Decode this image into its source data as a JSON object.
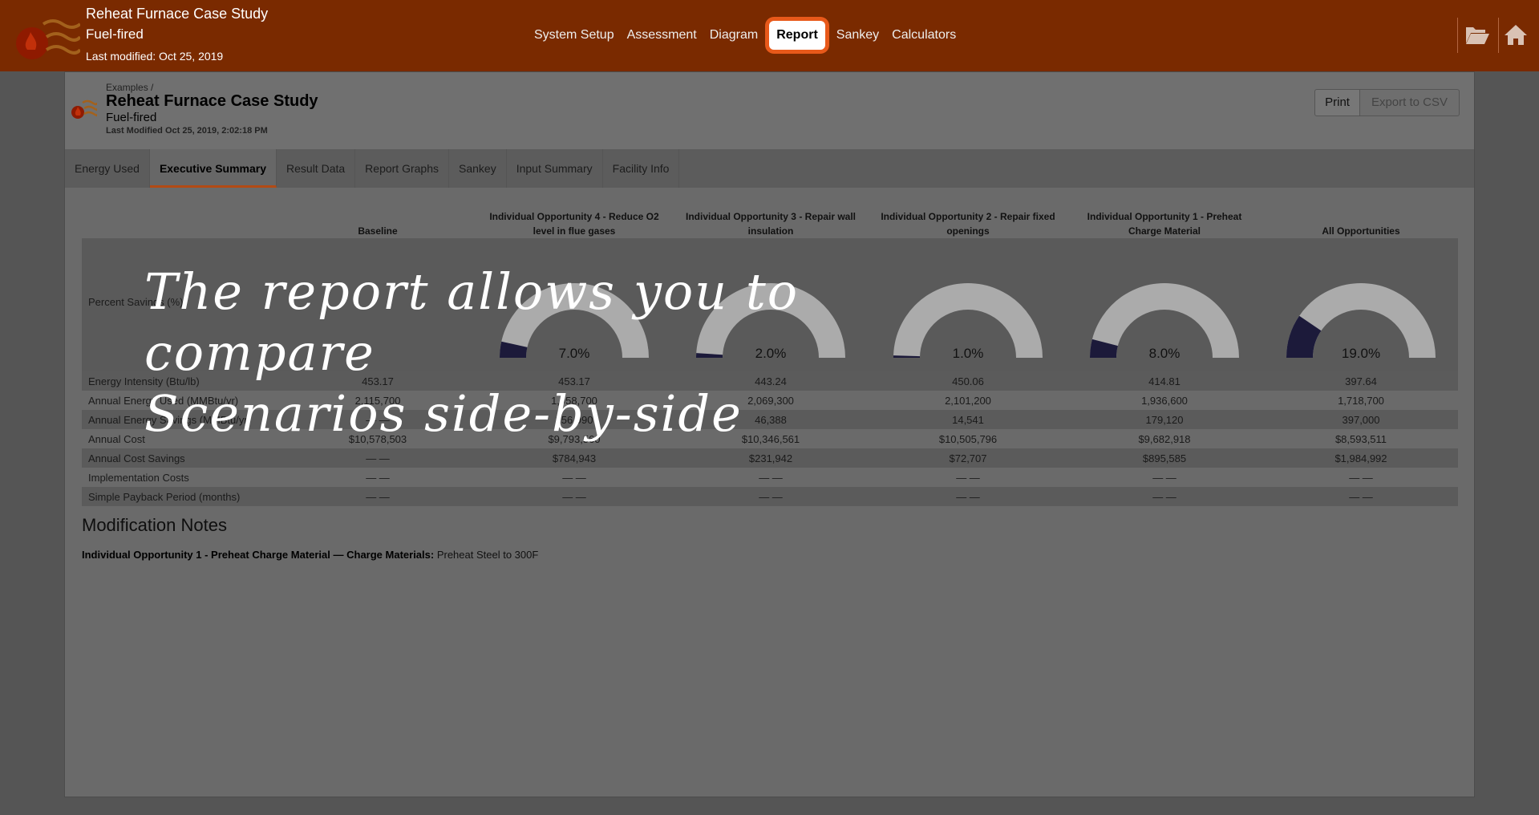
{
  "app": {
    "title": "Reheat Furnace Case Study",
    "subtitle": "Fuel-fired",
    "last_modified": "Last modified: Oct 25, 2019"
  },
  "main_nav": [
    "System Setup",
    "Assessment",
    "Diagram",
    "Report",
    "Sankey",
    "Calculators"
  ],
  "active_nav": "Report",
  "top_icons": [
    "folder-open-icon",
    "home-icon"
  ],
  "report": {
    "breadcrumb": "Examples /",
    "title": "Reheat Furnace Case Study",
    "subtitle": "Fuel-fired",
    "last_modified": "Last Modified Oct 25, 2019, 2:02:18 PM",
    "print_label": "Print",
    "export_label": "Export to CSV"
  },
  "tabs": [
    "Energy Used",
    "Executive Summary",
    "Result Data",
    "Report Graphs",
    "Sankey",
    "Input Summary",
    "Facility Info"
  ],
  "active_tab": "Executive Summary",
  "summary": {
    "columns": [
      "Baseline",
      "Individual Opportunity 4 - Reduce O2 level in flue gases",
      "Individual Opportunity 3 - Repair wall insulation",
      "Individual Opportunity 2 - Repair fixed openings",
      "Individual Opportunity 1 - Preheat Charge Material",
      "All Opportunities"
    ],
    "percent_savings_label": "Percent Savings (%)",
    "percent_savings": [
      null,
      7.0,
      2.0,
      1.0,
      8.0,
      19.0
    ],
    "percent_savings_text": [
      "",
      "7.0%",
      "2.0%",
      "1.0%",
      "8.0%",
      "19.0%"
    ],
    "rows": [
      {
        "label": "Energy Intensity (Btu/lb)",
        "values": [
          "453.17",
          "453.17",
          "443.24",
          "450.06",
          "414.81",
          "397.64"
        ]
      },
      {
        "label": "Annual Energy Used (MMBtu/yr)",
        "values": [
          "2,115,700",
          "1,958,700",
          "2,069,300",
          "2,101,200",
          "1,936,600",
          "1,718,700"
        ]
      },
      {
        "label": "Annual Energy Savings (MMBtu/yr)",
        "values": [
          "— —",
          "156,990",
          "46,388",
          "14,541",
          "179,120",
          "397,000"
        ]
      },
      {
        "label": "Annual Cost",
        "values": [
          "$10,578,503",
          "$9,793,560",
          "$10,346,561",
          "$10,505,796",
          "$9,682,918",
          "$8,593,511"
        ]
      },
      {
        "label": "Annual Cost Savings",
        "values": [
          "— —",
          "$784,943",
          "$231,942",
          "$72,707",
          "$895,585",
          "$1,984,992"
        ]
      },
      {
        "label": "Implementation Costs",
        "values": [
          "— —",
          "— —",
          "— —",
          "— —",
          "— —",
          "— —"
        ]
      },
      {
        "label": "Simple Payback Period (months)",
        "values": [
          "— —",
          "— —",
          "— —",
          "— —",
          "— —",
          "— —"
        ]
      }
    ]
  },
  "notes": {
    "title": "Modification Notes",
    "line_bold": "Individual Opportunity 1 - Preheat Charge Material — Charge Materials:",
    "line_text": " Preheat Steel to 300F"
  },
  "caption": {
    "line1": "The report allows you to compare",
    "line2": "Scenarios side-by-side"
  },
  "colors": {
    "topbar": "#7a2a00",
    "active_nav_outline": "#e8591a",
    "gauge_fill": "#1c1a3a",
    "gauge_track": "#efefef"
  }
}
